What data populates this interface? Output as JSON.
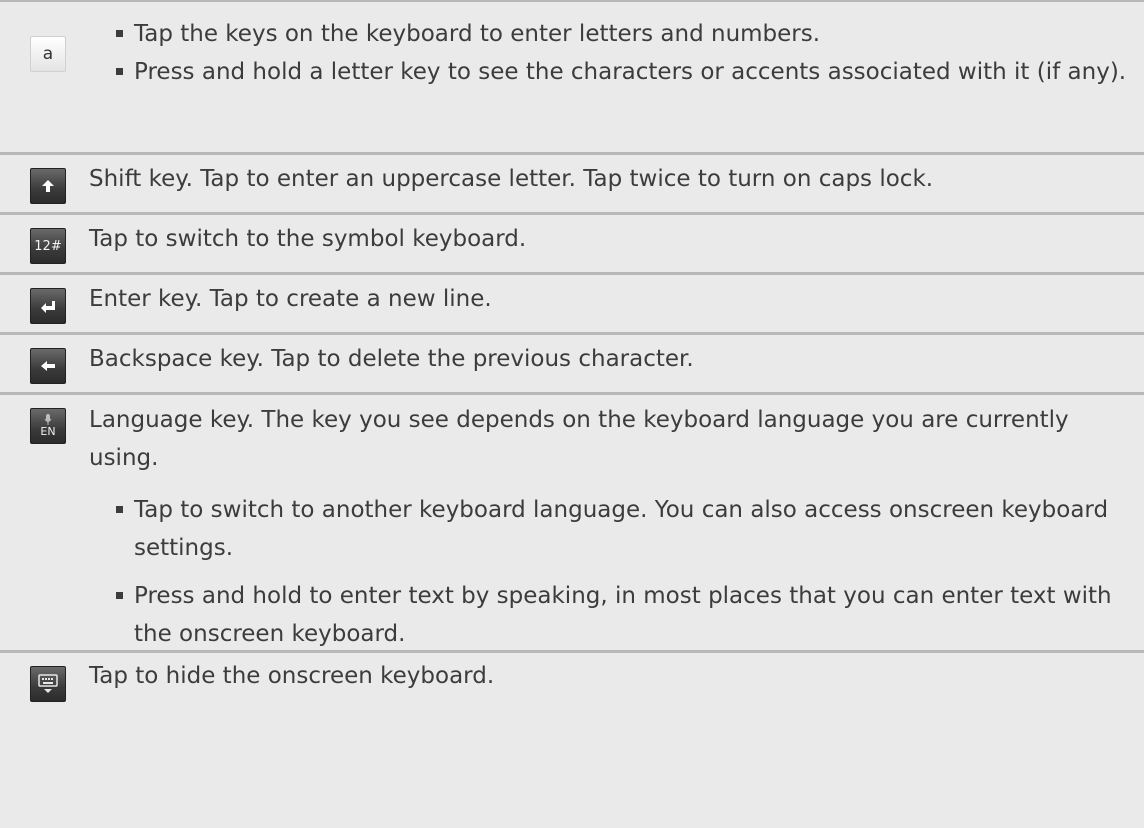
{
  "rows": [
    {
      "key_label": "a",
      "key_icon": "letter-a-key",
      "bullets": [
        "Tap the keys on the keyboard to enter letters and numbers.",
        "Press and hold a letter key to see the characters or accents associated with it (if any)."
      ]
    },
    {
      "key_icon": "shift-arrow-icon",
      "text": "Shift key. Tap to enter an uppercase letter. Tap twice to turn on caps lock."
    },
    {
      "key_label": "12#",
      "key_icon": "symbol-key",
      "text": "Tap to switch to the symbol keyboard."
    },
    {
      "key_icon": "enter-arrow-icon",
      "text": "Enter key. Tap to create a new line."
    },
    {
      "key_icon": "backspace-arrow-icon",
      "text": "Backspace key. Tap to delete the previous character."
    },
    {
      "key_label": "EN",
      "key_icon": "microphone-icon",
      "text": "Language key. The key you see depends on the keyboard language you are currently using.",
      "bullets": [
        "Tap to switch to another keyboard language. You can also access onscreen keyboard settings.",
        "Press and hold to enter text by speaking, in most places that you can enter text with the onscreen keyboard."
      ]
    },
    {
      "key_icon": "hide-keyboard-icon",
      "text": "Tap to hide the onscreen keyboard."
    }
  ],
  "colors": {
    "background": "#eaeaea",
    "separator": "#b8b8b8",
    "text": "#3c3c3c",
    "dark_key": "#3a3a3a",
    "light_key": "#f4f4f4"
  }
}
